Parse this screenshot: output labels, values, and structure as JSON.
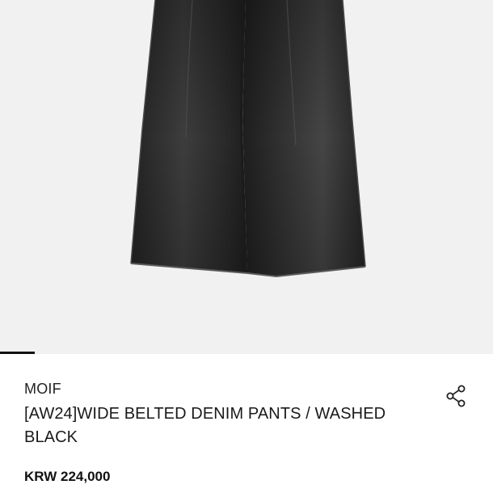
{
  "product": {
    "brand": "MOIF",
    "title": "[AW24]WIDE BELTED DENIM PANTS / WASHED BLACK",
    "price": "KRW 224,000"
  },
  "image": {
    "description_icon": "wide-black-denim-pants",
    "background_color": "#f1f1f1",
    "garment_color": "#2b2b2b"
  },
  "carousel": {
    "current_slide_fraction": 0.07
  },
  "actions": {
    "share_icon": "share-icon"
  }
}
